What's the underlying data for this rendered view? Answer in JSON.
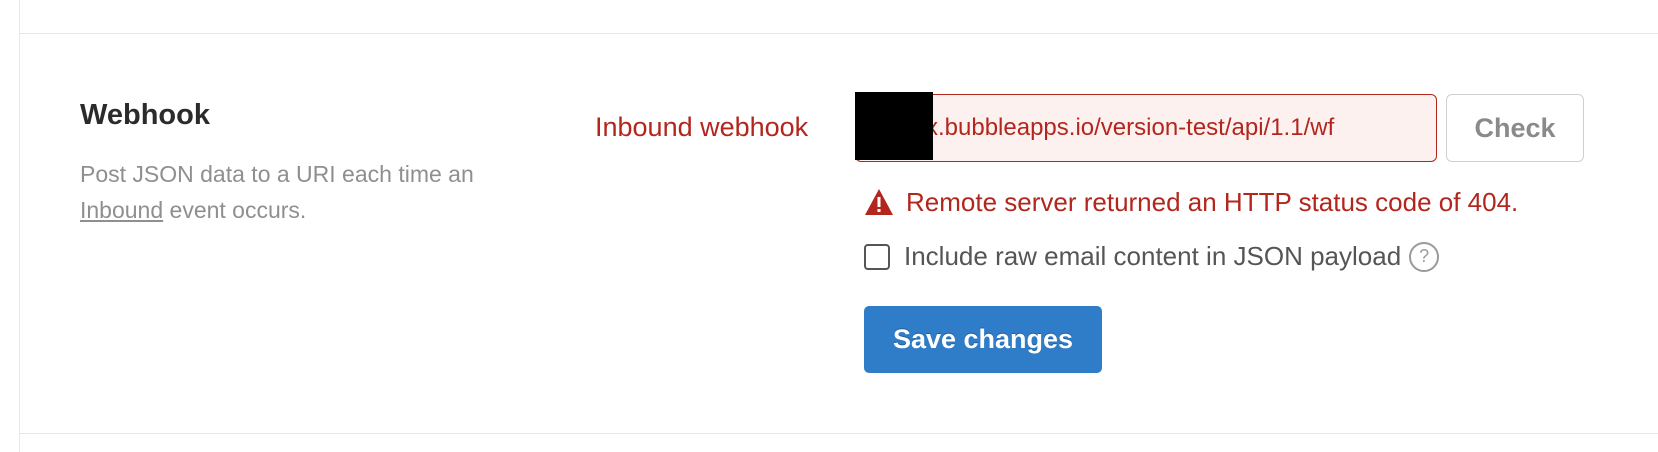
{
  "section": {
    "title": "Webhook",
    "description_before": "Post JSON data to a URI each time an ",
    "description_link": "Inbound",
    "description_after": " event occurs."
  },
  "webhook": {
    "label": "Inbound webhook",
    "url_value": "x.bubbleapps.io/version-test/api/1.1/wf",
    "check_label": "Check"
  },
  "error": {
    "icon": "warning-triangle-icon",
    "message": "Remote server returned an HTTP status code of 404."
  },
  "options": {
    "raw_email_label": "Include raw email content in JSON payload",
    "raw_email_checked": false,
    "help_glyph": "?"
  },
  "actions": {
    "save_label": "Save changes"
  },
  "colors": {
    "error": "#b3261e",
    "primary": "#2f7cc9"
  }
}
